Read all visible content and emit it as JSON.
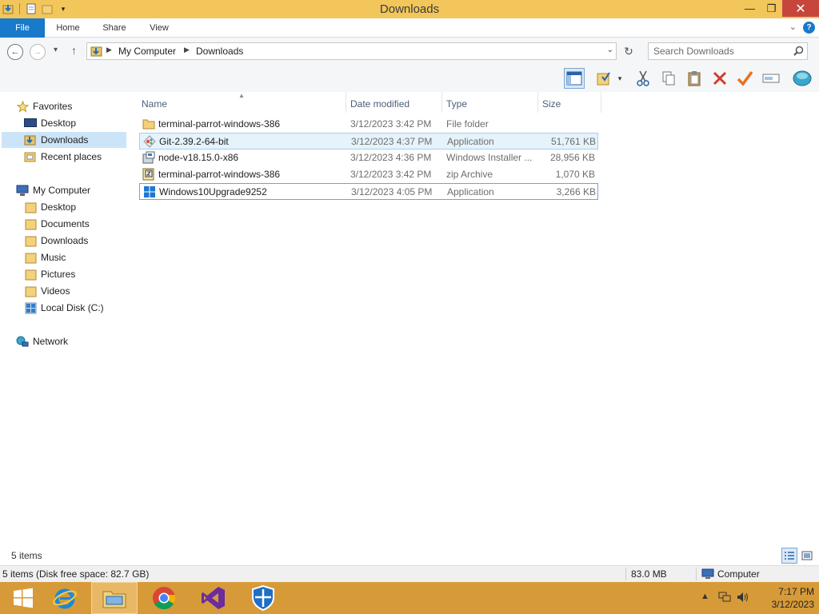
{
  "window": {
    "title": "Downloads"
  },
  "ribbon": {
    "tabs": [
      "File",
      "Home",
      "Share",
      "View"
    ]
  },
  "address": {
    "crumbs": [
      "My Computer",
      "Downloads"
    ]
  },
  "search": {
    "placeholder": "Search Downloads"
  },
  "nav": {
    "favorites_label": "Favorites",
    "favorites": [
      "Desktop",
      "Downloads",
      "Recent places"
    ],
    "computer_label": "My Computer",
    "computer": [
      "Desktop",
      "Documents",
      "Downloads",
      "Music",
      "Pictures",
      "Videos",
      "Local Disk (C:)"
    ],
    "network_label": "Network"
  },
  "columns": {
    "name": "Name",
    "date": "Date modified",
    "type": "Type",
    "size": "Size"
  },
  "files": [
    {
      "name": "terminal-parrot-windows-386",
      "date": "3/12/2023 3:42 PM",
      "type": "File folder",
      "size": "",
      "icon": "folder-icon"
    },
    {
      "name": "Git-2.39.2-64-bit",
      "date": "3/12/2023 4:37 PM",
      "type": "Application",
      "size": "51,761 KB",
      "icon": "git-icon"
    },
    {
      "name": "node-v18.15.0-x86",
      "date": "3/12/2023 4:36 PM",
      "type": "Windows Installer ...",
      "size": "28,956 KB",
      "icon": "installer-icon"
    },
    {
      "name": "terminal-parrot-windows-386",
      "date": "3/12/2023 3:42 PM",
      "type": "zip Archive",
      "size": "1,070 KB",
      "icon": "zip-icon"
    },
    {
      "name": "Windows10Upgrade9252",
      "date": "3/12/2023 4:05 PM",
      "type": "Application",
      "size": "3,266 KB",
      "icon": "windows-icon"
    }
  ],
  "status": {
    "item_count": "5 items",
    "disk": "5 items (Disk free space: 82.7 GB)",
    "size": "83.0 MB",
    "location": "Computer"
  },
  "clock": {
    "time": "7:17 PM",
    "date": "3/12/2023"
  },
  "colors": {
    "titlebar": "#f2c65b",
    "taskbar": "#d79a38",
    "file_tab": "#1979ca",
    "close": "#c7463c"
  }
}
